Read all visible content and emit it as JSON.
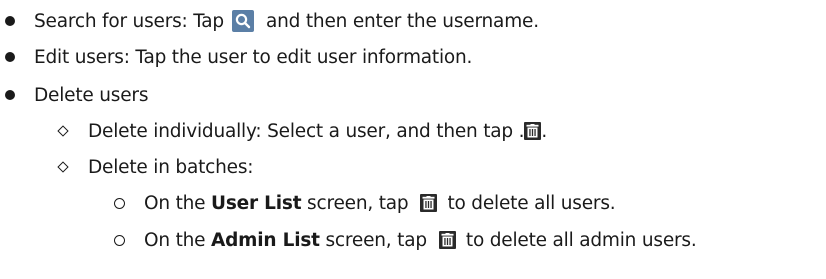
{
  "bullets": {
    "search": {
      "prefix": "Search for users: Tap",
      "icon": "search-icon",
      "suffix": "and then enter the username."
    },
    "edit": {
      "text": "Edit users: Tap the user to edit user information."
    },
    "delete": {
      "text": "Delete users",
      "individually": {
        "prefix": "Delete individually: Select a user, and then tap .",
        "icon": "delete-icon",
        "suffix": "."
      },
      "batches": {
        "text": "Delete in batches:",
        "user_list": {
          "prefix": "On the",
          "bold": "User List",
          "middle": "screen, tap",
          "icon": "delete-icon",
          "suffix": "to delete all users."
        },
        "admin_list": {
          "prefix": "On the",
          "bold": "Admin List",
          "middle": "screen, tap",
          "icon": "delete-icon",
          "suffix": "to delete all admin users."
        }
      }
    }
  },
  "colors": {
    "text": "#1a1a1a",
    "search_icon_bg": "#5b7fa6",
    "delete_icon_bg": "#2a2a2a"
  }
}
